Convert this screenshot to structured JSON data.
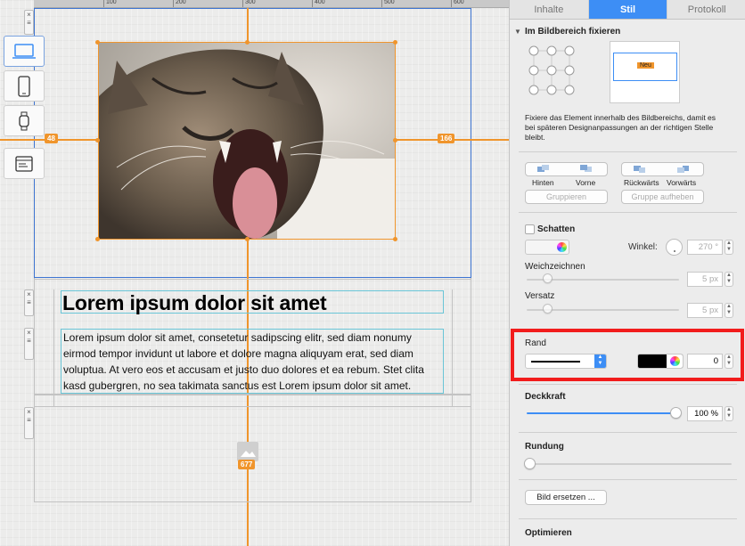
{
  "ruler": {
    "labels": [
      "100",
      "200",
      "300",
      "400",
      "500",
      "600"
    ]
  },
  "devices": [
    {
      "name": "desktop-icon",
      "selected": true
    },
    {
      "name": "phone-icon",
      "selected": false
    },
    {
      "name": "watch-icon",
      "selected": false
    },
    {
      "name": "browser-icon",
      "selected": false
    }
  ],
  "canvas": {
    "distance_left": "48",
    "distance_right": "166",
    "distance_bottom": "677",
    "headline": "Lorem ipsum dolor sit amet",
    "body": "Lorem ipsum dolor sit amet, consetetur sadipscing elitr, sed diam nonumy eirmod tempor invidunt ut labore et dolore magna aliquyam erat, sed diam voluptua. At vero eos et accusam et justo duo dolores et ea rebum. Stet clita kasd gubergren, no sea takimata sanctus est Lorem ipsum dolor sit amet.",
    "image_alt": "yawning cat photo"
  },
  "panel": {
    "tabs": [
      "Inhalte",
      "Stil",
      "Protokoll"
    ],
    "active_tab": "Stil",
    "fix": {
      "title": "Im Bildbereich fixieren",
      "preview_label": "Neu",
      "description": "Fixiere das Element innerhalb des Bildbereichs, damit es bei späteren Designanpassungen an der richtigen Stelle bleibt."
    },
    "arrange": {
      "hinten": "Hinten",
      "vorne": "Vorne",
      "rueckwaerts": "Rückwärts",
      "vorwaerts": "Vorwärts",
      "gruppieren": "Gruppieren",
      "gruppe_aufheben": "Gruppe aufheben"
    },
    "shadow": {
      "label": "Schatten",
      "angle_label": "Winkel:",
      "angle_value": "270 °",
      "blur_label": "Weichzeichnen",
      "blur_value": "5 px",
      "offset_label": "Versatz",
      "offset_value": "5 px"
    },
    "border": {
      "label": "Rand",
      "width_value": "0",
      "color": "#000000"
    },
    "opacity": {
      "label": "Deckkraft",
      "value": "100 %",
      "level": 1.0
    },
    "rounding": {
      "label": "Rundung",
      "level": 0.0
    },
    "replace_button": "Bild ersetzen ...",
    "optimize": "Optimieren"
  },
  "colors": {
    "accent": "#3d8ef5",
    "selection": "#f0952c",
    "section_border": "#3d74d1",
    "highlight_red": "#f21c1c",
    "text_box_border": "#69c5d7"
  }
}
